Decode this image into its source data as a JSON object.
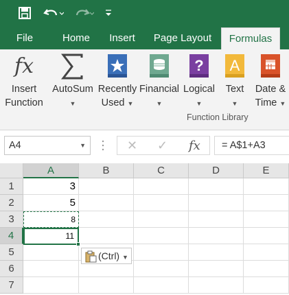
{
  "qat": {
    "save_icon": "save-icon",
    "undo_icon": "undo-icon",
    "redo_icon": "redo-icon",
    "customize_icon": "customize-qat-icon"
  },
  "tabs": [
    {
      "label": "File",
      "active": false
    },
    {
      "label": "Home",
      "active": false
    },
    {
      "label": "Insert",
      "active": false
    },
    {
      "label": "Page Layout",
      "active": false
    },
    {
      "label": "Formulas",
      "active": true
    }
  ],
  "ribbon": {
    "buttons": {
      "insert_function": {
        "line1": "Insert",
        "line2": "Function",
        "icon": "fx-icon"
      },
      "autosum": {
        "line1": "AutoSum",
        "icon": "sigma-icon"
      },
      "recently_used": {
        "line1": "Recently",
        "line2": "Used",
        "icon": "star-book-icon"
      },
      "financial": {
        "line1": "Financial",
        "icon": "coins-book-icon"
      },
      "logical": {
        "line1": "Logical",
        "icon": "question-book-icon"
      },
      "text": {
        "line1": "Text",
        "icon": "text-book-icon"
      },
      "date_time": {
        "line1": "Date &",
        "line2": "Time",
        "icon": "calendar-book-icon"
      }
    },
    "group_label": "Function Library"
  },
  "formula_bar": {
    "name_box": "A4",
    "formula": "= A$1+A3"
  },
  "grid": {
    "columns": [
      "A",
      "B",
      "C",
      "D",
      "E"
    ],
    "rows": [
      "1",
      "2",
      "3",
      "4",
      "5",
      "6",
      "7"
    ],
    "values": {
      "A1": "3",
      "A2": "5",
      "A3": "8",
      "A4": "11"
    }
  },
  "paste_options": {
    "label": "(Ctrl)",
    "icon": "clipboard-icon"
  },
  "colors": {
    "accent": "#217346",
    "ribbon_bg": "#f3f3f3"
  }
}
